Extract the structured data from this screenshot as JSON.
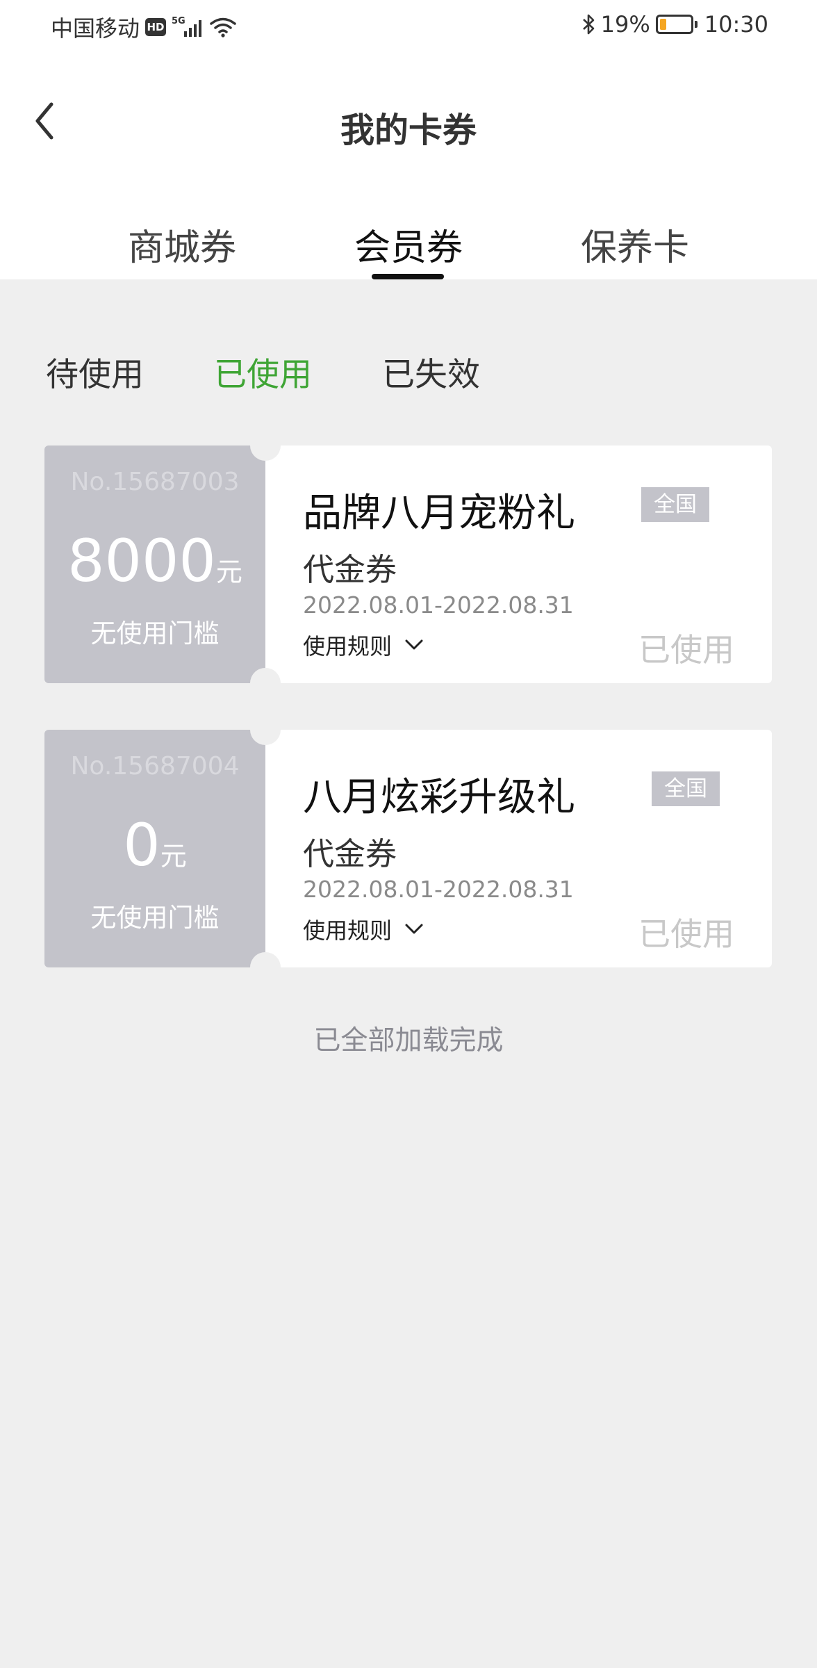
{
  "status_bar": {
    "carrier": "中国移动",
    "hd_badge": "HD",
    "network": "5G",
    "battery_percent": "19%",
    "time": "10:30"
  },
  "header": {
    "title": "我的卡券"
  },
  "tabs": [
    {
      "label": "商城券"
    },
    {
      "label": "会员券"
    },
    {
      "label": "保养卡"
    }
  ],
  "subtabs": [
    {
      "label": "待使用"
    },
    {
      "label": "已使用"
    },
    {
      "label": "已失效"
    }
  ],
  "coupons": [
    {
      "number": "No.15687003",
      "amount": "8000",
      "unit": "元",
      "threshold": "无使用门槛",
      "title": "品牌八月宠粉礼",
      "scope": "全国",
      "type": "代金券",
      "validity": "2022.08.01-2022.08.31",
      "rules_label": "使用规则",
      "status": "已使用"
    },
    {
      "number": "No.15687004",
      "amount": "0",
      "unit": "元",
      "threshold": "无使用门槛",
      "title": "八月炫彩升级礼",
      "scope": "全国",
      "type": "代金券",
      "validity": "2022.08.01-2022.08.31",
      "rules_label": "使用规则",
      "status": "已使用"
    }
  ],
  "footer": {
    "loaded_text": "已全部加载完成"
  },
  "colors": {
    "accent_green": "#3fa535",
    "coupon_gray": "#c3c3ca",
    "background": "#efefef"
  }
}
